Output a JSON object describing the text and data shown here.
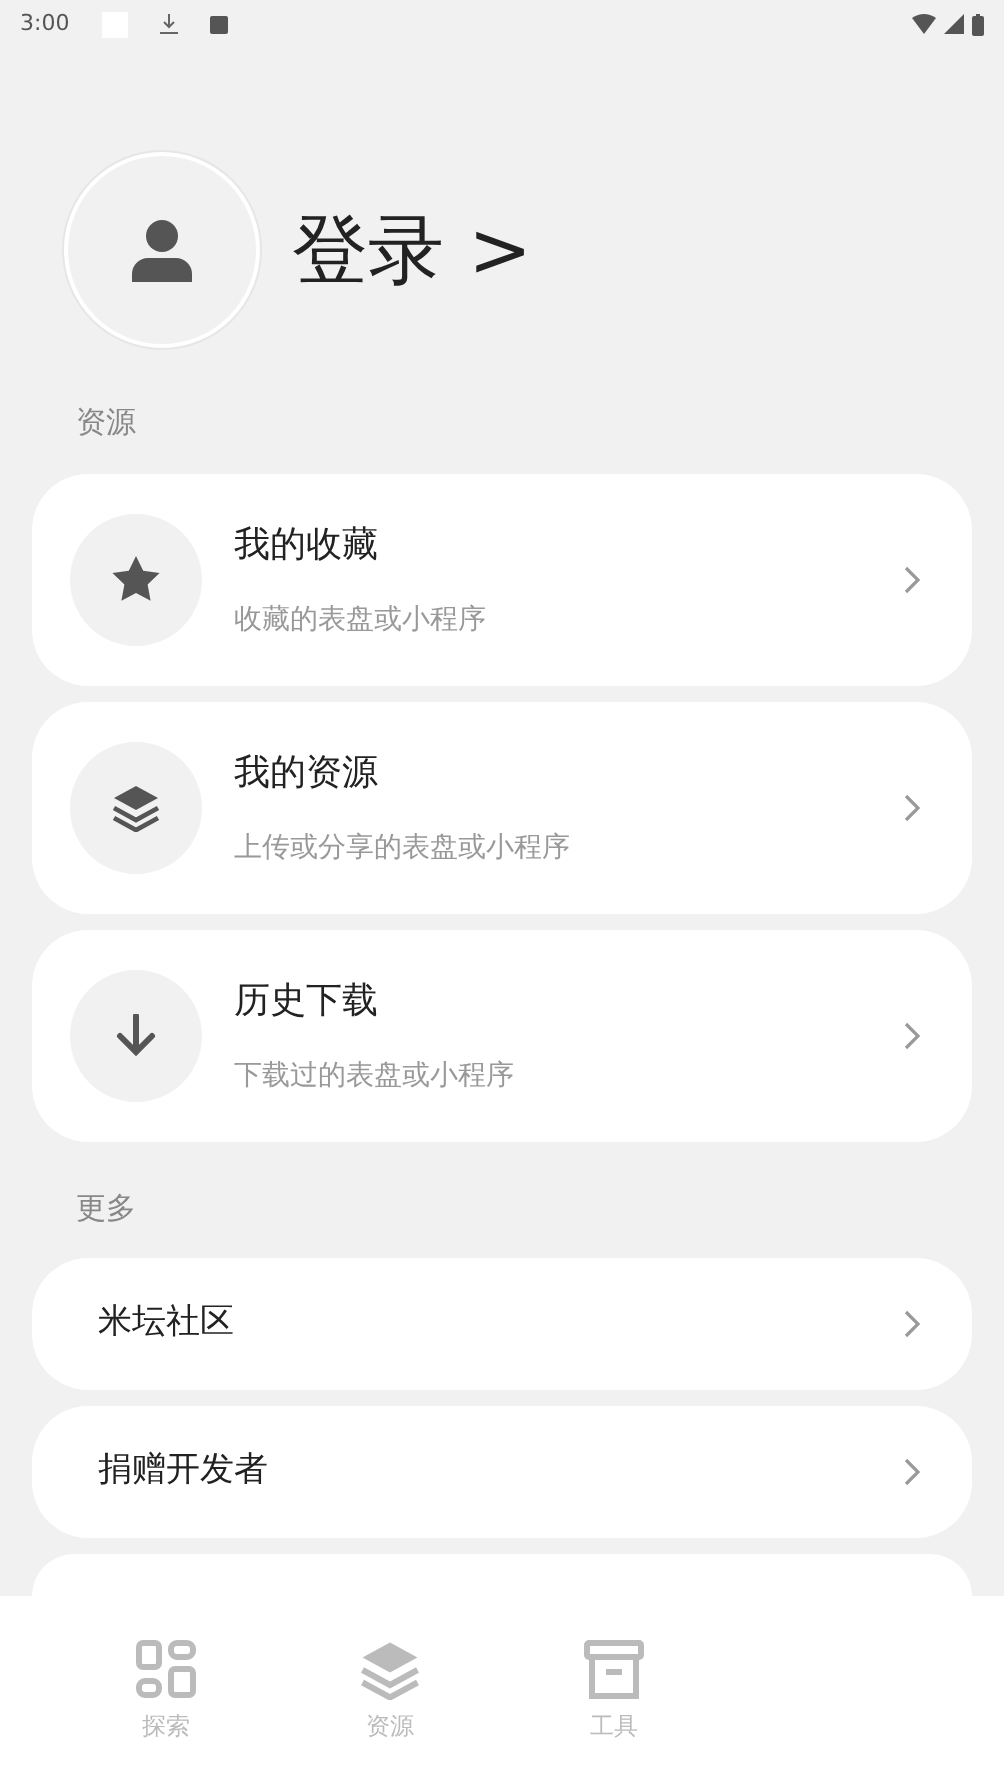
{
  "status_bar": {
    "time": "3:00"
  },
  "profile": {
    "login_label": "登录 >"
  },
  "resources": {
    "heading": "资源",
    "items": [
      {
        "kind": "star",
        "title": "我的收藏",
        "subtitle": "收藏的表盘或小程序"
      },
      {
        "kind": "layers",
        "title": "我的资源",
        "subtitle": "上传或分享的表盘或小程序"
      },
      {
        "kind": "download",
        "title": "历史下载",
        "subtitle": "下载过的表盘或小程序"
      }
    ]
  },
  "more": {
    "heading": "更多",
    "items": [
      {
        "title": "米坛社区"
      },
      {
        "title": "捐赠开发者"
      }
    ]
  },
  "bottom_nav": [
    {
      "kind": "grid",
      "label": "探索",
      "selected": false
    },
    {
      "kind": "layers",
      "label": "资源",
      "selected": false
    },
    {
      "kind": "archive",
      "label": "工具",
      "selected": false
    }
  ]
}
